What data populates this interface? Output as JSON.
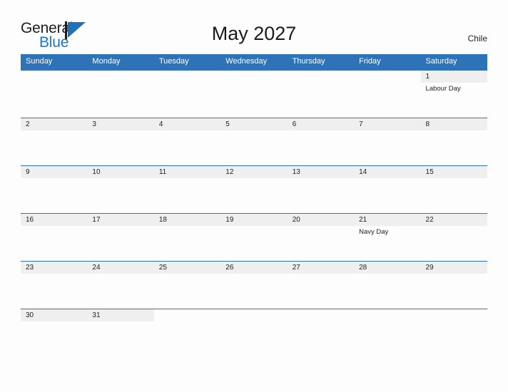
{
  "logo": {
    "word1": "General",
    "word2": "Blue",
    "icon": "triangle-flag-icon"
  },
  "header": {
    "title": "May 2027",
    "region": "Chile"
  },
  "colors": {
    "header_blue": "#2e72b8",
    "logo_blue": "#1878c8",
    "day_band_gray": "#efefef",
    "page_background": "#fdfdfd",
    "text": "#222222"
  },
  "calendar": {
    "month": "May",
    "year": "2027",
    "weekday_headers": [
      "Sunday",
      "Monday",
      "Tuesday",
      "Wednesday",
      "Thursday",
      "Friday",
      "Saturday"
    ],
    "weeks": [
      [
        {
          "day": "",
          "event": ""
        },
        {
          "day": "",
          "event": ""
        },
        {
          "day": "",
          "event": ""
        },
        {
          "day": "",
          "event": ""
        },
        {
          "day": "",
          "event": ""
        },
        {
          "day": "",
          "event": ""
        },
        {
          "day": "1",
          "event": "Labour Day"
        }
      ],
      [
        {
          "day": "2",
          "event": ""
        },
        {
          "day": "3",
          "event": ""
        },
        {
          "day": "4",
          "event": ""
        },
        {
          "day": "5",
          "event": ""
        },
        {
          "day": "6",
          "event": ""
        },
        {
          "day": "7",
          "event": ""
        },
        {
          "day": "8",
          "event": ""
        }
      ],
      [
        {
          "day": "9",
          "event": ""
        },
        {
          "day": "10",
          "event": ""
        },
        {
          "day": "11",
          "event": ""
        },
        {
          "day": "12",
          "event": ""
        },
        {
          "day": "13",
          "event": ""
        },
        {
          "day": "14",
          "event": ""
        },
        {
          "day": "15",
          "event": ""
        }
      ],
      [
        {
          "day": "16",
          "event": ""
        },
        {
          "day": "17",
          "event": ""
        },
        {
          "day": "18",
          "event": ""
        },
        {
          "day": "19",
          "event": ""
        },
        {
          "day": "20",
          "event": ""
        },
        {
          "day": "21",
          "event": "Navy Day"
        },
        {
          "day": "22",
          "event": ""
        }
      ],
      [
        {
          "day": "23",
          "event": ""
        },
        {
          "day": "24",
          "event": ""
        },
        {
          "day": "25",
          "event": ""
        },
        {
          "day": "26",
          "event": ""
        },
        {
          "day": "27",
          "event": ""
        },
        {
          "day": "28",
          "event": ""
        },
        {
          "day": "29",
          "event": ""
        }
      ],
      [
        {
          "day": "30",
          "event": ""
        },
        {
          "day": "31",
          "event": ""
        },
        {
          "day": "",
          "event": ""
        },
        {
          "day": "",
          "event": ""
        },
        {
          "day": "",
          "event": ""
        },
        {
          "day": "",
          "event": ""
        },
        {
          "day": "",
          "event": ""
        }
      ]
    ],
    "holidays": [
      {
        "date": "1",
        "name": "Labour Day"
      },
      {
        "date": "21",
        "name": "Navy Day"
      }
    ]
  }
}
